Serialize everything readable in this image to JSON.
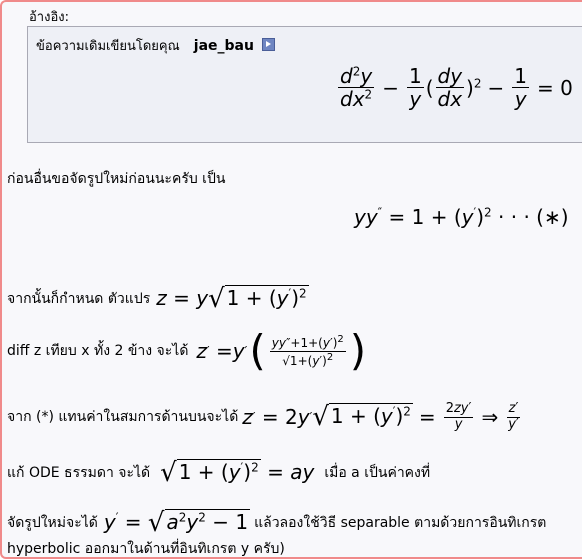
{
  "quote": {
    "label": "อ้างอิง:",
    "original_prefix": "ข้อความเดิมเขียนโดยคุณ",
    "author": "jae_bau",
    "view_icon": "view-post-icon",
    "equation": "d²y/dx² − 1/y (dy/dx)² − 1/y = 0"
  },
  "post": {
    "line1": "ก่อนอื่นขอจัดรูปใหม่ก่อนนะครับ  เป็น",
    "eq1": "yy″ = 1 + (y′)² · · · (∗)",
    "line2_text": "จากนั้นก็กำหนด  ตัวแปร",
    "line3_text": "diff z เทียบ  x ทั้ง  2 ข้าง  จะได้",
    "line4_text": "จาก  (*) แทนค่าในสมการด้านบนจะได้",
    "line5_text": "แก้  ODE ธรรมดา  จะได้",
    "line5_tail": "เมื่อ  a เป็นค่าคงที่",
    "line6_text": "จัดรูปใหม่จะได้",
    "line6_tail": "แล้วลองใช้วิธี  separable ตามด้วยการอินทิเกรต",
    "line7_text": "hyperbolic ออกมาในด้านที่อินทิเกรต  y ครับ)"
  },
  "colors": {
    "frame_border": "#f08a8a",
    "quote_bg": "#eef0f6",
    "page_bg": "#f8f8fb"
  }
}
